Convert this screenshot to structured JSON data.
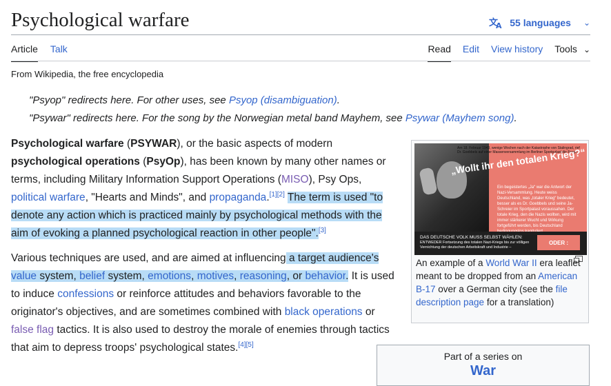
{
  "article": {
    "title": "Psychological warfare",
    "tagline": "From Wikipedia, the free encyclopedia"
  },
  "languages": {
    "label": "55 languages"
  },
  "tabs": {
    "article": "Article",
    "talk": "Talk",
    "read": "Read",
    "edit": "Edit",
    "history": "View history",
    "tools": "Tools"
  },
  "hatnotes": [
    {
      "prefix": "\"Psyop\" redirects here. For other uses, see ",
      "link": "Psyop (disambiguation)",
      "suffix": "."
    },
    {
      "prefix": "\"Psywar\" redirects here. For the song by the Norwegian metal band Mayhem, see ",
      "link": "Psywar (Mayhem song)",
      "suffix": "."
    }
  ],
  "p1": {
    "b1": "Psychological warfare",
    "t1": " (",
    "b2": "PSYWAR",
    "t2": "), or the basic aspects of modern ",
    "b3": "psychological operations",
    "t3": " (",
    "b4": "PsyOp",
    "t4": "), has been known by many other names or terms, including Military Information Support Operations (",
    "miso": "MISO",
    "t5": "), Psy Ops, ",
    "l_polwar": "political warfare",
    "t6": ", \"Hearts and Minds\", and ",
    "l_prop": "propaganda",
    "t7": ".",
    "ref12": "[1][2]",
    "t8": " ",
    "hl1": "The term is used \"to denote any action which is practiced mainly by psychological methods with the aim of evoking a planned psychological reaction in other people\".",
    "ref3": "[3]"
  },
  "p2": {
    "t1": "Various techniques are used, and are aimed at influencing",
    "h1": " a target audience's ",
    "l_value": "value",
    "t2": " system, ",
    "l_belief": "belief",
    "t3": " system, ",
    "l_emotions": "emotions",
    "c1": ", ",
    "l_motives": "motives",
    "c2": ", ",
    "l_reasoning": "reasoning",
    "c3": ", or ",
    "l_behavior": "behavior",
    "c4": ".",
    "t4": " It is used to induce ",
    "l_confessions": "confessions",
    "t5": " or reinforce attitudes and behaviors favorable to the originator's objectives, and are sometimes combined with ",
    "l_blackops": "black operations",
    "t6": " or ",
    "l_falseflag": "false flag",
    "t7": " tactics. It is also used to destroy the morale of enemies through tactics that aim to depress troops' psychological states.",
    "ref45": "[4][5]"
  },
  "infobox": {
    "leaflet_headline": "„Wollt ihr den totalen Krieg?“",
    "leaflet_top": "Am 18. Februar 1943, wenige Wochen nach der Katastrophe von Stalingrad, rief Dr. Goebbels auf einer Massenversammlung im Berliner Sportpalast die Frage:",
    "leaflet_body": "Ein begeistertes „Ja“ war die Antwort der Nazi-Versammlung. Heute weiss Deutschland, was „totaler Krieg“ bedeutet, besser als es Dr. Goebbels und seine Ja-Schreier im Sportpalast voraussahen. Der totale Krieg, den die Nazis wollten, wird mit immer stärkerer Wucht und Wirkung fortgeführt werden, bis Deutschland bedingungslos kapituliert.",
    "leaflet_band1": "DAS DEUTSCHE VOLK MUSS SELBST WÄHLEN:",
    "leaflet_band2": "ENTWEDER Fortsetzung des totalen Nazi-Kriegs bis zur völligen Vernichtung der deutschen Arbeitskraft und Industrie –",
    "leaflet_oder": "ODER :",
    "cap1": "An example of a ",
    "cap_ww2": "World War II",
    "cap2": " era leaflet meant to be dropped from an ",
    "cap_b17": "American B-17",
    "cap3": " over a German city (see the ",
    "cap_fdp": "file description page",
    "cap4": " for a translation)"
  },
  "series": {
    "label": "Part of a series on",
    "topic": "War"
  },
  "colors": {
    "link": "#3366cc",
    "visited": "#795cb2",
    "highlight": "#b8dcf6",
    "text": "#202122"
  }
}
